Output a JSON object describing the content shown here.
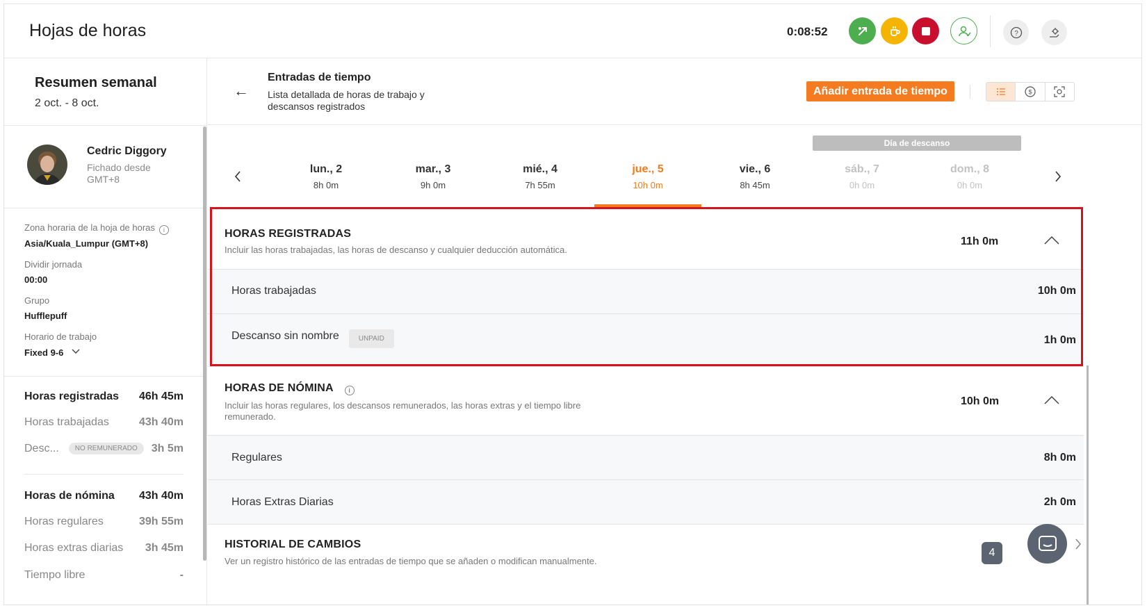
{
  "app": {
    "title": "Hojas de horas",
    "timer": "0:08:52"
  },
  "icons": {
    "topbar": [
      "switch-task-icon",
      "coffee-break-icon",
      "stop-icon",
      "user-add-icon",
      "help-icon",
      "settings-icon"
    ],
    "colors": {
      "green": "#4cae4f",
      "yellow": "#f5b400",
      "red": "#c8102e",
      "accent": "#f47b20",
      "highlight": "#d6121c"
    }
  },
  "sidebar": {
    "title": "Resumen semanal",
    "range": "2 oct. - 8 oct.",
    "user": {
      "name": "Cedric Diggory",
      "subtitle": "Fichado desde GMT+8"
    },
    "info": [
      {
        "label": "Zona horaria de la hoja de horas",
        "value": "Asia/Kuala_Lumpur (GMT+8)"
      },
      {
        "label": "Dividir jornada",
        "value": "00:00"
      },
      {
        "label": "Grupo",
        "value": "Hufflepuff"
      },
      {
        "label": "Horario de trabajo",
        "value": "Fixed 9-6"
      }
    ],
    "stats": [
      {
        "label": "Horas registradas",
        "value": "46h 45m",
        "strong": true
      },
      {
        "label": "Horas trabajadas",
        "value": "43h 40m",
        "strong": false
      },
      {
        "label": "Desc...",
        "badge": "NO REMUNERADO",
        "value": "3h 5m",
        "strong": false
      },
      {
        "label": "Horas de nómina",
        "value": "43h 40m",
        "strong": true
      },
      {
        "label": "Horas regulares",
        "value": "39h 55m",
        "strong": false
      },
      {
        "label": "Horas extras diarias",
        "value": "3h 45m",
        "strong": false
      },
      {
        "label": "Tiempo libre",
        "value": "-",
        "strong": false
      }
    ]
  },
  "main": {
    "header": {
      "title": "Entradas de tiempo",
      "description": "Lista detallada de horas de trabajo y descansos registrados",
      "add_button": "Añadir entrada de tiempo"
    },
    "rest_day_badge": "Día de descanso",
    "days": [
      {
        "name": "lun., 2",
        "hours": "8h 0m",
        "state": "normal"
      },
      {
        "name": "mar., 3",
        "hours": "9h 0m",
        "state": "normal"
      },
      {
        "name": "mié., 4",
        "hours": "7h 55m",
        "state": "normal"
      },
      {
        "name": "jue., 5",
        "hours": "10h 0m",
        "state": "active"
      },
      {
        "name": "vie., 6",
        "hours": "8h 45m",
        "state": "normal"
      },
      {
        "name": "sáb., 7",
        "hours": "0h 0m",
        "state": "disabled"
      },
      {
        "name": "dom., 8",
        "hours": "0h 0m",
        "state": "disabled"
      }
    ],
    "tracked": {
      "title": "HORAS REGISTRADAS",
      "subtitle": "Incluir las horas trabajadas, las horas de descanso y cualquier deducción automática.",
      "total": "11h 0m",
      "rows": [
        {
          "label": "Horas trabajadas",
          "value": "10h 0m"
        },
        {
          "label": "Descanso sin nombre",
          "badge": "UNPAID",
          "value": "1h 0m"
        }
      ]
    },
    "payroll": {
      "title": "HORAS DE NÓMINA",
      "subtitle": "Incluir las horas regulares, los descansos remunerados, las horas extras y el tiempo libre remunerado.",
      "total": "10h 0m",
      "rows": [
        {
          "label": "Regulares",
          "value": "8h 0m"
        },
        {
          "label": "Horas Extras Diarias",
          "value": "2h 0m"
        }
      ]
    },
    "history": {
      "title": "HISTORIAL DE CAMBIOS",
      "subtitle": "Ver un registro histórico de las entradas de tiempo que se añaden o modifican manualmente.",
      "badge": "4"
    }
  }
}
